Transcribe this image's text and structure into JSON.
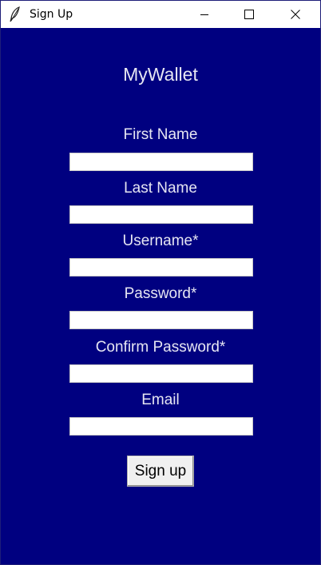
{
  "window": {
    "title": "Sign Up",
    "icon": "feather-icon",
    "controls": [
      "minimize-icon",
      "maximize-icon",
      "close-icon"
    ]
  },
  "app": {
    "title": "MyWallet"
  },
  "form": {
    "fields": [
      {
        "label": "First Name",
        "value": ""
      },
      {
        "label": "Last Name",
        "value": ""
      },
      {
        "label": "Username*",
        "value": ""
      },
      {
        "label": "Password*",
        "value": ""
      },
      {
        "label": "Confirm Password*",
        "value": ""
      },
      {
        "label": "Email",
        "value": ""
      }
    ],
    "submit_label": "Sign up"
  },
  "colors": {
    "background": "#000080",
    "label_text": "#e6e6f2",
    "input_background": "#ffffff",
    "button_background": "#f0f0f0"
  }
}
